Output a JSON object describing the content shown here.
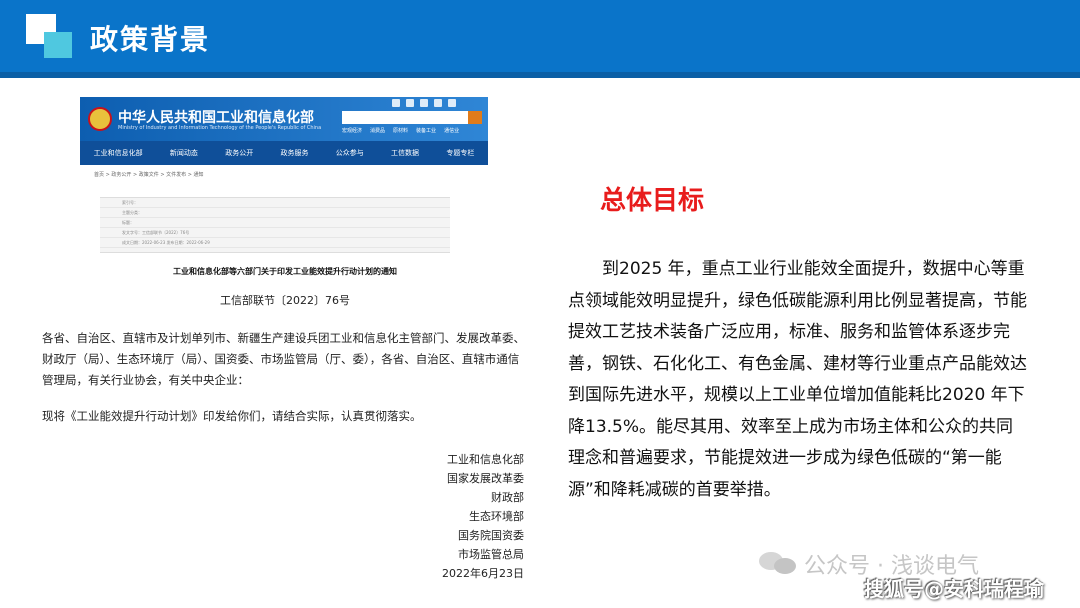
{
  "header": {
    "title": "政策背景",
    "colors": {
      "band": "#0a74c9",
      "accent": "#4fc8e0"
    }
  },
  "website": {
    "name": "中华人民共和国工业和信息化部",
    "english_name": "Ministry of Industry and Information Technology of the People's Republic of China",
    "nav": [
      "工业和信息化部",
      "新闻动态",
      "政务公开",
      "政务服务",
      "公众参与",
      "工信数据",
      "专题专栏"
    ],
    "quick_links": [
      "宏观经济",
      "消费品",
      "原材料",
      "装备工业",
      "通信业"
    ],
    "breadcrumb": "首页 > 政务公开 > 政策文件 > 文件发布 > 通知",
    "meta_rows": [
      "索引号：",
      "主题分类：",
      "标题：",
      "发文字号：工信部联节〔2022〕76号",
      "成文日期：2022-06-23    发布日期：2022-06-29"
    ]
  },
  "document": {
    "title": "工业和信息化部等六部门关于印发工业能效提升行动计划的通知",
    "number": "工信部联节〔2022〕76号",
    "recipients": "各省、自治区、直辖市及计划单列市、新疆生产建设兵团工业和信息化主管部门、发展改革委、财政厅（局）、生态环境厅（局）、国资委、市场监管局（厅、委），各省、自治区、直辖市通信管理局，有关行业协会，有关中央企业：",
    "body": "现将《工业能效提升行动计划》印发给你们，请结合实际，认真贯彻落实。",
    "signers": [
      "工业和信息化部",
      "国家发展改革委",
      "财政部",
      "生态环境部",
      "国务院国资委",
      "市场监管总局"
    ],
    "date": "2022年6月23日"
  },
  "goal": {
    "heading": "总体目标",
    "text": "到2025 年，重点工业行业能效全面提升，数据中心等重点领域能效明显提升，绿色低碳能源利用比例显著提高，节能提效工艺技术装备广泛应用，标准、服务和监管体系逐步完善，钢铁、石化化工、有色金属、建材等行业重点产品能效达到国际先进水平，规模以上工业单位增加值能耗比2020 年下降13.5%。能尽其用、效率至上成为市场主体和公众的共同理念和普遍要求，节能提效进一步成为绿色低碳的“第一能源”和降耗减碳的首要举措。",
    "heading_color": "#e81c1c"
  },
  "watermarks": {
    "account": "公众号 · 浅谈电气",
    "source": "搜狐号@安科瑞程瑜"
  }
}
